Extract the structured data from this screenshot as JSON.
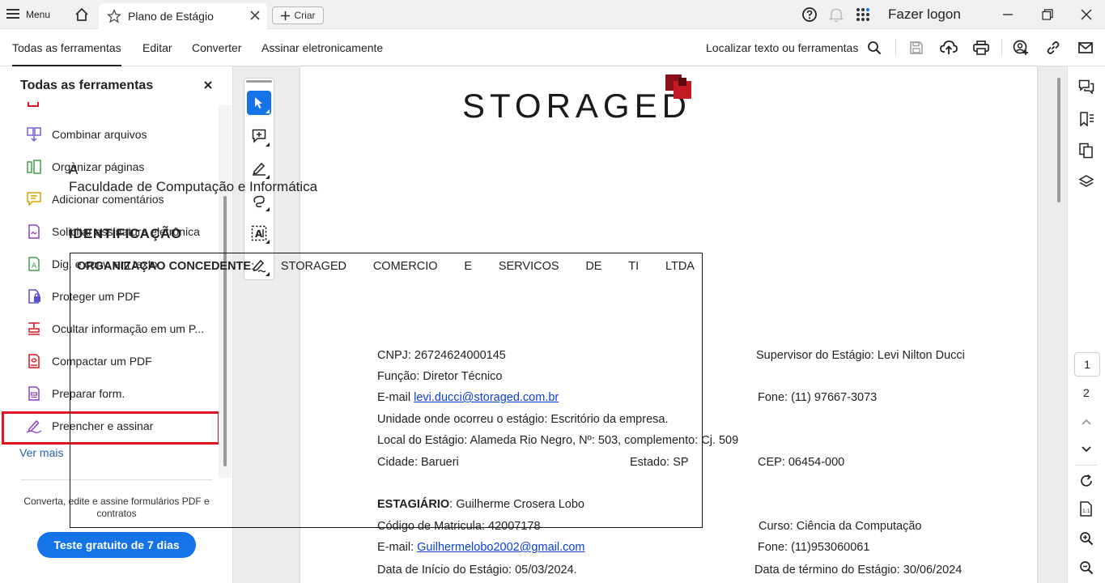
{
  "titlebar": {
    "menu_label": "Menu",
    "tab_title": "Plano de Estágio",
    "create_label": "Criar",
    "signin_label": "Fazer logon"
  },
  "menubar": {
    "tabs": [
      "Todas as ferramentas",
      "Editar",
      "Converter",
      "Assinar eletronicamente"
    ],
    "active_tab": "Todas as ferramentas",
    "find_label": "Localizar texto ou ferramentas"
  },
  "left_panel": {
    "title": "Todas as ferramentas",
    "tools": [
      {
        "label": "Combinar arquivos",
        "icon": "combine-files-icon"
      },
      {
        "label": "Organizar páginas",
        "icon": "organize-pages-icon"
      },
      {
        "label": "Adicionar comentários",
        "icon": "add-comment-icon"
      },
      {
        "label": "Solicitar assinatura eletrônica",
        "icon": "request-signature-icon"
      },
      {
        "label": "Dig. e conv. em texto",
        "icon": "scan-ocr-icon"
      },
      {
        "label": "Proteger um PDF",
        "icon": "protect-pdf-icon"
      },
      {
        "label": "Ocultar informação em um P...",
        "icon": "redact-icon"
      },
      {
        "label": "Compactar um PDF",
        "icon": "compress-pdf-icon"
      },
      {
        "label": "Preparar form.",
        "icon": "prepare-form-icon"
      },
      {
        "label": "Preencher e assinar",
        "icon": "fill-sign-icon"
      }
    ],
    "more_label": "Ver mais",
    "promo_text": "Converta, edite e assine formulários PDF e contratos",
    "trial_button": "Teste gratuito de 7 dias"
  },
  "document": {
    "logo_text": "STORAGED",
    "addr_line1": "À",
    "addr_line2": "Faculdade de Computação e Informática",
    "section_title": "IDENTIFICAÇÃO",
    "org_label": "ORGANIZAÇAO CONCEDENTE",
    "org_value_words": [
      "STORAGED",
      "COMERCIO",
      "E",
      "SERVICOS",
      "DE",
      "TI",
      "LTDA"
    ],
    "cnpj": "CNPJ: 26724624000145",
    "supervisor": "Supervisor do Estágio: Levi Nilton Ducci",
    "funcao": "Função: Diretor Técnico",
    "email_label": "E-mail ",
    "email_org": "levi.ducci@storaged.com.br",
    "fone_org": "Fone: (11) 97667-3073",
    "unidade": "Unidade onde ocorreu o estágio: Escritório da empresa.",
    "local": "Local do Estágio: Alameda Rio Negro, Nº: 503, complemento: Cj. 509",
    "cidade": "Cidade: Barueri",
    "estado": "Estado: SP",
    "cep": "CEP: 06454-000",
    "estagiario_label": "ESTAGIÁRIO",
    "estagiario_value": ": Guilherme Crosera Lobo",
    "matricula": "Código de Matricula: 42007178",
    "curso": "Curso: Ciência da Computação",
    "email2_label": "E-mail: ",
    "email_estagiario": "Guilhermelobo2002@gmail.com",
    "fone_estagiario": "Fone: (11)953060061",
    "inicio": "Data de Início do Estágio: 05/03/2024.",
    "termino": "Data de término do Estágio: 30/06/2024"
  },
  "pagination": {
    "current_page": "1",
    "next_page": "2"
  },
  "colors": {
    "accent": "#1473e6",
    "highlight_border": "#e0141e",
    "logo_red": "#b5121b",
    "link": "#0b3fd6"
  }
}
